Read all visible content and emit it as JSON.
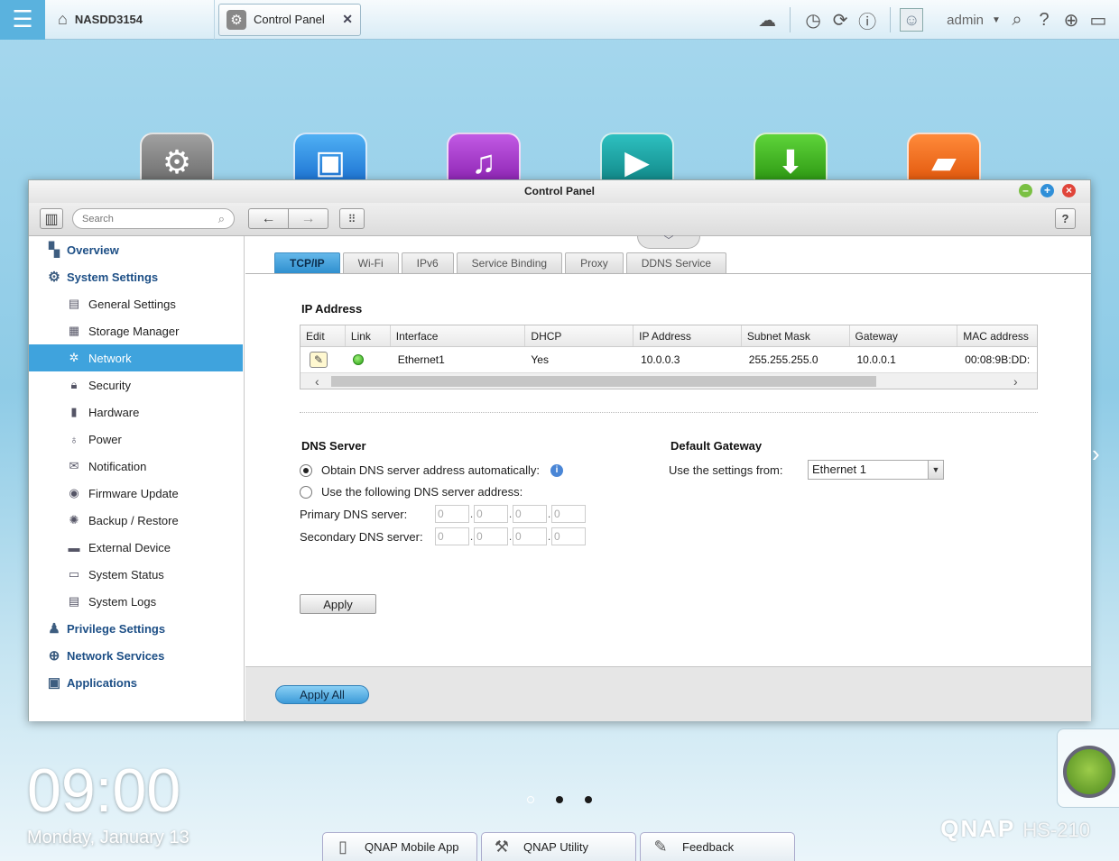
{
  "topbar": {
    "host_name": "NASDD3154",
    "open_tab_label": "Control Panel",
    "user_name": "admin",
    "icons": [
      "menu-icon",
      "home-icon",
      "cloud-icon",
      "clock-icon",
      "sync-icon",
      "info-icon",
      "user-icon",
      "search-icon",
      "help-icon",
      "globe-icon",
      "monitor-icon"
    ]
  },
  "desktop": {
    "app_icons": [
      {
        "name": "control-panel-app",
        "icon": "gear-icon",
        "color": "#808080"
      },
      {
        "name": "photo-station-app",
        "icon": "photo-icon",
        "color": "#1a7fd8"
      },
      {
        "name": "music-station-app",
        "icon": "music-icon",
        "color": "#a23bc8"
      },
      {
        "name": "video-station-app",
        "icon": "video-icon",
        "color": "#1a9a9a"
      },
      {
        "name": "download-station-app",
        "icon": "download-icon",
        "color": "#3aa81c"
      },
      {
        "name": "file-station-app",
        "icon": "folder-icon",
        "color": "#f06a12"
      }
    ],
    "clock": "09:00",
    "date": "Monday, January 13",
    "dock": [
      {
        "label": "QNAP Mobile App",
        "icon": "phone-icon"
      },
      {
        "label": "QNAP Utility",
        "icon": "hammer-icon"
      },
      {
        "label": "Feedback",
        "icon": "edit-icon"
      }
    ],
    "brand": "QNAP",
    "model": "HS-210"
  },
  "window": {
    "title": "Control Panel",
    "search_placeholder": "Search",
    "help_label": "?",
    "sidebar": {
      "items": [
        {
          "label": "Overview",
          "level": "top",
          "icon": "overview-icon"
        },
        {
          "label": "System Settings",
          "level": "top",
          "icon": "gear-icon"
        },
        {
          "label": "General Settings",
          "level": "sub",
          "icon": "settings-doc-icon"
        },
        {
          "label": "Storage Manager",
          "level": "sub",
          "icon": "disk-icon"
        },
        {
          "label": "Network",
          "level": "sub",
          "icon": "network-icon",
          "active": true
        },
        {
          "label": "Security",
          "level": "sub",
          "icon": "lock-icon"
        },
        {
          "label": "Hardware",
          "level": "sub",
          "icon": "hardware-icon"
        },
        {
          "label": "Power",
          "level": "sub",
          "icon": "bulb-icon"
        },
        {
          "label": "Notification",
          "level": "sub",
          "icon": "notification-icon"
        },
        {
          "label": "Firmware Update",
          "level": "sub",
          "icon": "firmware-icon"
        },
        {
          "label": "Backup / Restore",
          "level": "sub",
          "icon": "backup-icon"
        },
        {
          "label": "External Device",
          "level": "sub",
          "icon": "external-device-icon"
        },
        {
          "label": "System Status",
          "level": "sub",
          "icon": "monitor-icon"
        },
        {
          "label": "System Logs",
          "level": "sub",
          "icon": "log-icon"
        },
        {
          "label": "Privilege Settings",
          "level": "top",
          "icon": "user-icon"
        },
        {
          "label": "Network Services",
          "level": "top",
          "icon": "globe-icon"
        },
        {
          "label": "Applications",
          "level": "top",
          "icon": "apps-icon"
        }
      ]
    },
    "tabs": [
      "TCP/IP",
      "Wi-Fi",
      "IPv6",
      "Service Binding",
      "Proxy",
      "DDNS Service"
    ],
    "active_tab": "TCP/IP",
    "ip_section": {
      "title": "IP Address",
      "columns": [
        "Edit",
        "Link",
        "Interface",
        "DHCP",
        "IP Address",
        "Subnet Mask",
        "Gateway",
        "MAC address"
      ],
      "rows": [
        {
          "interface": "Ethernet1",
          "dhcp": "Yes",
          "ip": "10.0.0.3",
          "mask": "255.255.255.0",
          "gateway": "10.0.0.1",
          "mac": "00:08:9B:DD:"
        }
      ]
    },
    "dns": {
      "title": "DNS Server",
      "auto_label": "Obtain DNS server address automatically:",
      "manual_label": "Use the following DNS server address:",
      "selected": "auto",
      "primary_label": "Primary DNS server:",
      "secondary_label": "Secondary DNS server:",
      "primary_octets": [
        "0",
        "0",
        "0",
        "0"
      ],
      "secondary_octets": [
        "0",
        "0",
        "0",
        "0"
      ]
    },
    "gateway": {
      "title": "Default Gateway",
      "label": "Use the settings from:",
      "value": "Ethernet 1"
    },
    "apply_label": "Apply",
    "apply_all_label": "Apply All"
  }
}
